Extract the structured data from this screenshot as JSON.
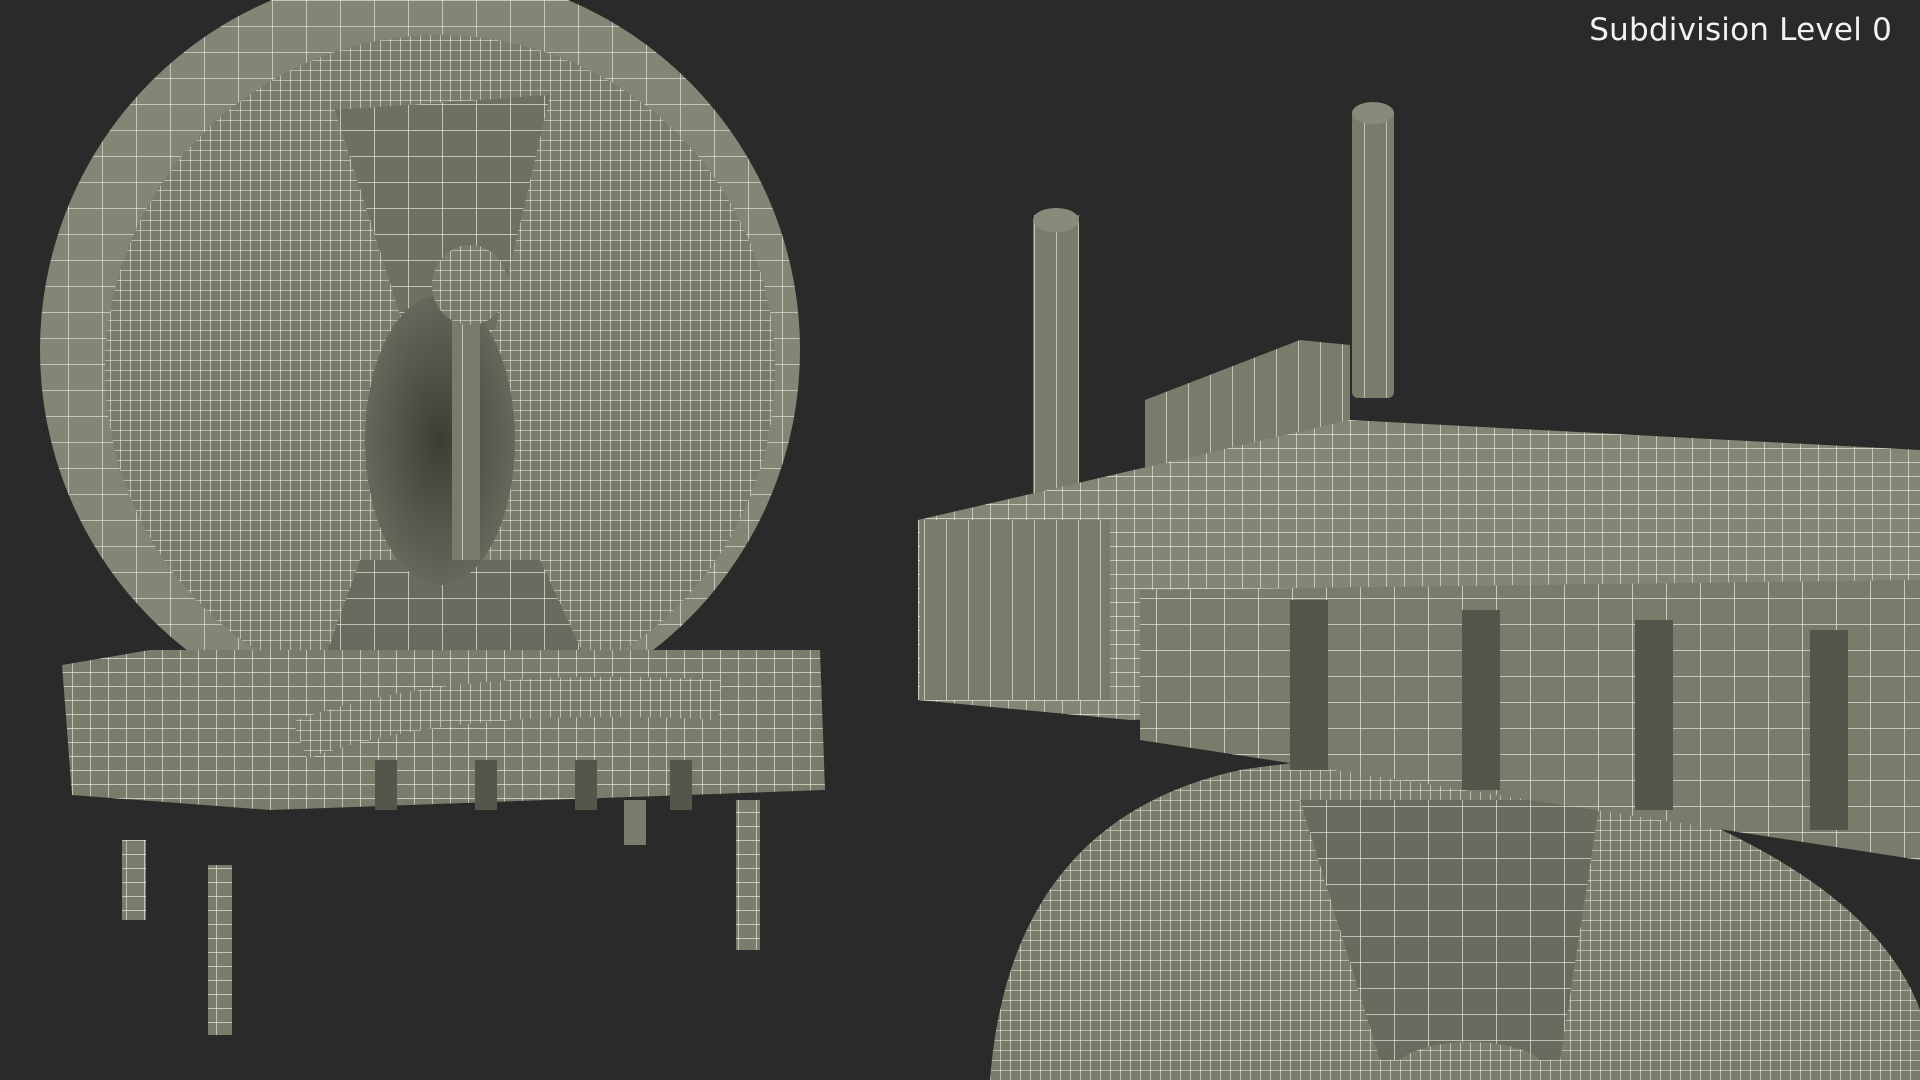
{
  "overlay": {
    "label": "Subdivision Level 0"
  },
  "colors": {
    "background": "#2a2a2a",
    "surface": "#7b7b6c",
    "surface_dark": "#5a5a4f",
    "surface_light": "#8a8a7a",
    "wire": "#f2f2e6"
  },
  "icons": [
    "toroid-inductor-model",
    "toroid-inductor-closeup"
  ]
}
